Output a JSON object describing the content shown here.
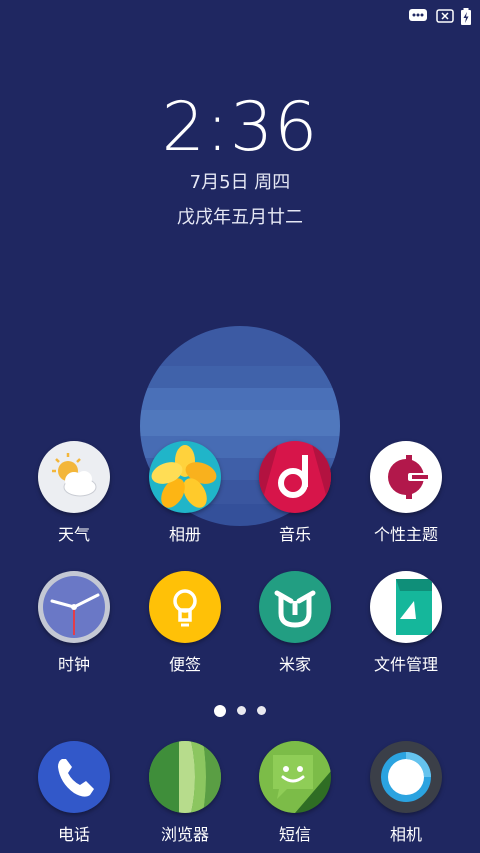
{
  "status_bar": {
    "icons": [
      "message-icon",
      "no-sim-icon",
      "battery-charging-icon"
    ]
  },
  "lockscreen": {
    "time": "2:36",
    "date": "7月5日 周四",
    "lunar_date": "戊戌年五月廿二"
  },
  "home": {
    "row1": [
      {
        "label": "天气",
        "icon": "weather-icon"
      },
      {
        "label": "相册",
        "icon": "gallery-icon"
      },
      {
        "label": "音乐",
        "icon": "music-icon"
      },
      {
        "label": "个性主题",
        "icon": "themes-icon"
      }
    ],
    "row2": [
      {
        "label": "时钟",
        "icon": "clock-icon"
      },
      {
        "label": "便签",
        "icon": "notes-icon"
      },
      {
        "label": "米家",
        "icon": "mijia-icon"
      },
      {
        "label": "文件管理",
        "icon": "file-manager-icon"
      }
    ],
    "page_indicator": {
      "pages": 3,
      "current": 1
    }
  },
  "dock": [
    {
      "label": "电话",
      "icon": "phone-icon"
    },
    {
      "label": "浏览器",
      "icon": "browser-icon"
    },
    {
      "label": "短信",
      "icon": "messages-icon"
    },
    {
      "label": "相机",
      "icon": "camera-icon"
    }
  ],
  "colors": {
    "wallpaper": "#1f2761",
    "widget_blue": "#4a6fb5"
  }
}
